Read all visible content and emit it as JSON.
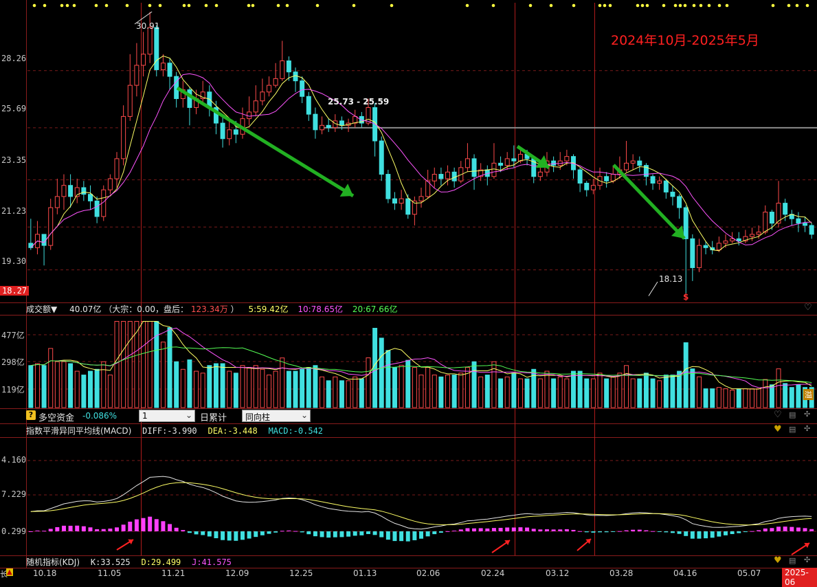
{
  "header": {
    "period_title": "2024年10月-2025年5月"
  },
  "price_panel": {
    "y_ticks": [
      "28.26",
      "25.69",
      "23.35",
      "21.23",
      "19.30"
    ],
    "y_ticks_values": [
      28.26,
      25.69,
      23.35,
      21.23,
      19.3
    ],
    "last_price_tag": "18.27",
    "high_label": "30.91",
    "low_label": "18.13",
    "resistance_label": "25.73 - 25.59",
    "resistance_value": 25.69,
    "dollar_marker": "$"
  },
  "volume_panel": {
    "title": "成交额▼",
    "value": "40.07亿",
    "paren": "（大宗：0.00，盘后：",
    "after_value": "123.34万",
    "paren_close": "）",
    "ma5": "5:59.42亿",
    "ma10": "10:78.65亿",
    "ma20": "20:67.66亿",
    "y_ticks": [
      "477亿",
      "298亿",
      "119亿"
    ],
    "corner_badge": "溢"
  },
  "fund_bar": {
    "help_icon": "?",
    "title": "多空资金",
    "value": "-0.086%",
    "select1": "1",
    "mode_label": "日累计",
    "select2": "同向柱"
  },
  "macd_panel": {
    "title": "指数平滑异同平均线(MACD)",
    "diff": "DIFF:-3.990",
    "dea": "DEA:-3.448",
    "macd": "MACD:-0.542",
    "y_ticks": [
      "4.160",
      "7.229",
      "0.299"
    ]
  },
  "kdj_panel": {
    "title": "随机指标(KDJ)",
    "k": "K:33.525",
    "d": "D:29.499",
    "j": "J:41.575"
  },
  "x_axis": {
    "left_marker": "长",
    "left_warn": "▲",
    "dates": [
      "10.18",
      "11.05",
      "11.21",
      "12.09",
      "12.25",
      "01.13",
      "02.06",
      "02.24",
      "03.12",
      "03.28",
      "04.16",
      "05.07"
    ],
    "current_date": "2025-06"
  },
  "colors": {
    "up": "#ff4b4b",
    "down": "#40e0e0",
    "ma5": "#ffff66",
    "ma10": "#ff55ff",
    "ma20": "#55ff55",
    "grid": "#7a1a1a",
    "arrow_green": "#22b022",
    "arrow_red": "#ff2222",
    "title_red": "#ff2020"
  },
  "chart_data": {
    "type": "candlestick",
    "ylim": [
      18.27,
      31.2
    ],
    "candles": [
      [
        20.5,
        20.3,
        21.6,
        20.2
      ],
      [
        20.3,
        20.9,
        21.5,
        20.0
      ],
      [
        20.9,
        20.4,
        20.9,
        19.5
      ],
      [
        20.4,
        22.1,
        22.5,
        20.2
      ],
      [
        22.1,
        22.6,
        23.4,
        21.8
      ],
      [
        22.6,
        23.1,
        23.6,
        22.0
      ],
      [
        23.1,
        22.6,
        23.6,
        22.1
      ],
      [
        22.6,
        23.0,
        23.4,
        22.3
      ],
      [
        23.0,
        22.7,
        23.3,
        22.4
      ],
      [
        22.7,
        22.4,
        23.1,
        22.0
      ],
      [
        22.4,
        21.7,
        22.6,
        21.4
      ],
      [
        21.7,
        22.9,
        23.1,
        21.5
      ],
      [
        22.9,
        23.4,
        23.6,
        22.7
      ],
      [
        23.4,
        24.3,
        24.6,
        23.0
      ],
      [
        24.3,
        26.2,
        26.7,
        24.0
      ],
      [
        26.2,
        27.6,
        29.0,
        26.0
      ],
      [
        27.6,
        28.5,
        29.5,
        27.1
      ],
      [
        28.5,
        29.0,
        30.0,
        28.0
      ],
      [
        29.0,
        30.2,
        30.9,
        28.6
      ],
      [
        30.2,
        28.3,
        30.3,
        28.0
      ],
      [
        28.3,
        28.6,
        29.0,
        28.0
      ],
      [
        28.6,
        28.0,
        28.8,
        27.4
      ],
      [
        28.0,
        27.0,
        28.2,
        26.6
      ],
      [
        27.0,
        27.4,
        27.8,
        26.6
      ],
      [
        27.4,
        26.6,
        27.5,
        25.8
      ],
      [
        26.6,
        27.0,
        27.4,
        26.3
      ],
      [
        27.0,
        27.3,
        27.8,
        26.8
      ],
      [
        27.3,
        26.6,
        27.6,
        26.2
      ],
      [
        26.6,
        25.9,
        26.9,
        25.4
      ],
      [
        25.9,
        25.2,
        26.3,
        24.8
      ],
      [
        25.2,
        25.6,
        26.0,
        24.9
      ],
      [
        25.6,
        25.4,
        26.0,
        25.0
      ],
      [
        25.4,
        26.1,
        26.6,
        25.2
      ],
      [
        26.1,
        26.4,
        27.1,
        25.8
      ],
      [
        26.4,
        26.9,
        27.6,
        26.2
      ],
      [
        26.9,
        27.3,
        27.9,
        26.7
      ],
      [
        27.3,
        27.6,
        28.0,
        27.1
      ],
      [
        27.6,
        27.9,
        28.6,
        27.5
      ],
      [
        27.9,
        28.7,
        29.6,
        27.8
      ],
      [
        28.7,
        28.2,
        28.9,
        27.8
      ],
      [
        28.2,
        27.8,
        28.4,
        27.3
      ],
      [
        27.8,
        27.1,
        28.0,
        26.8
      ],
      [
        27.1,
        26.3,
        27.3,
        26.0
      ],
      [
        26.3,
        25.6,
        26.6,
        25.2
      ],
      [
        25.6,
        25.8,
        26.2,
        25.4
      ],
      [
        25.8,
        25.7,
        26.1,
        25.5
      ],
      [
        25.7,
        26.0,
        26.3,
        25.5
      ],
      [
        26.0,
        25.8,
        26.2,
        25.6
      ],
      [
        25.8,
        25.9,
        26.1,
        25.5
      ],
      [
        25.9,
        26.2,
        26.5,
        25.7
      ],
      [
        26.2,
        25.9,
        26.4,
        25.7
      ],
      [
        25.9,
        26.6,
        27.0,
        25.8
      ],
      [
        26.6,
        25.1,
        26.8,
        24.4
      ],
      [
        25.1,
        23.6,
        25.3,
        23.3
      ],
      [
        23.6,
        22.5,
        23.8,
        22.3
      ],
      [
        22.5,
        22.3,
        22.8,
        22.0
      ],
      [
        22.3,
        22.5,
        22.9,
        22.0
      ],
      [
        22.5,
        21.8,
        22.7,
        21.6
      ],
      [
        21.8,
        22.4,
        22.6,
        21.3
      ],
      [
        22.4,
        22.6,
        23.0,
        22.1
      ],
      [
        22.6,
        23.3,
        23.8,
        22.5
      ],
      [
        23.3,
        23.6,
        23.9,
        23.0
      ],
      [
        23.6,
        23.4,
        23.9,
        23.1
      ],
      [
        23.4,
        23.7,
        24.0,
        23.1
      ],
      [
        23.7,
        23.3,
        23.9,
        23.0
      ],
      [
        23.3,
        23.9,
        24.2,
        23.2
      ],
      [
        23.9,
        24.3,
        25.0,
        23.7
      ],
      [
        24.3,
        23.5,
        24.5,
        22.9
      ],
      [
        23.5,
        23.8,
        24.1,
        23.3
      ],
      [
        23.8,
        23.5,
        24.0,
        23.1
      ],
      [
        23.5,
        24.1,
        25.0,
        23.4
      ],
      [
        24.1,
        24.0,
        24.4,
        23.7
      ],
      [
        24.0,
        24.3,
        24.6,
        23.8
      ],
      [
        24.3,
        24.2,
        24.9,
        23.9
      ],
      [
        24.2,
        24.5,
        24.8,
        24.1
      ],
      [
        24.5,
        24.3,
        24.7,
        24.0
      ],
      [
        24.3,
        23.5,
        24.4,
        23.2
      ],
      [
        23.5,
        23.7,
        24.0,
        23.3
      ],
      [
        23.7,
        24.2,
        24.6,
        23.5
      ],
      [
        24.2,
        24.0,
        24.4,
        23.7
      ],
      [
        24.0,
        24.2,
        24.6,
        23.8
      ],
      [
        24.2,
        24.4,
        24.7,
        24.0
      ],
      [
        24.4,
        23.8,
        24.5,
        23.4
      ],
      [
        23.8,
        23.2,
        23.9,
        22.8
      ],
      [
        23.2,
        22.9,
        23.3,
        22.6
      ],
      [
        22.9,
        23.1,
        23.4,
        22.7
      ],
      [
        23.1,
        23.5,
        23.9,
        22.9
      ],
      [
        23.5,
        23.3,
        23.7,
        23.0
      ],
      [
        23.3,
        23.6,
        24.0,
        23.2
      ],
      [
        23.6,
        23.8,
        24.4,
        23.4
      ],
      [
        23.8,
        24.1,
        25.1,
        23.7
      ],
      [
        24.1,
        24.2,
        24.5,
        23.8
      ],
      [
        24.2,
        24.0,
        24.4,
        23.7
      ],
      [
        24.0,
        23.5,
        24.1,
        23.1
      ],
      [
        23.5,
        23.2,
        23.6,
        22.9
      ],
      [
        23.2,
        23.3,
        23.5,
        22.9
      ],
      [
        23.3,
        22.8,
        23.4,
        22.5
      ],
      [
        22.8,
        22.6,
        23.1,
        22.2
      ],
      [
        22.6,
        22.1,
        22.7,
        21.6
      ],
      [
        22.1,
        20.7,
        22.2,
        18.13
      ],
      [
        20.7,
        19.4,
        20.9,
        18.8
      ],
      [
        19.4,
        20.4,
        20.7,
        19.2
      ],
      [
        20.4,
        20.3,
        20.6,
        20.0
      ],
      [
        20.3,
        20.2,
        20.6,
        20.0
      ],
      [
        20.2,
        20.5,
        20.8,
        20.1
      ],
      [
        20.5,
        20.6,
        20.9,
        20.3
      ],
      [
        20.6,
        20.7,
        21.0,
        20.5
      ],
      [
        20.7,
        20.6,
        21.0,
        20.4
      ],
      [
        20.6,
        20.8,
        21.1,
        20.5
      ],
      [
        20.8,
        20.9,
        21.2,
        20.6
      ],
      [
        20.9,
        21.0,
        21.3,
        20.7
      ],
      [
        21.0,
        21.9,
        22.2,
        20.9
      ],
      [
        21.9,
        21.4,
        22.0,
        21.1
      ],
      [
        21.4,
        22.3,
        23.3,
        21.2
      ],
      [
        22.3,
        21.8,
        22.5,
        21.5
      ],
      [
        21.8,
        21.6,
        22.0,
        21.3
      ],
      [
        21.6,
        21.4,
        21.9,
        21.0
      ],
      [
        21.4,
        21.3,
        21.7,
        21.0
      ],
      [
        21.3,
        20.9,
        21.4,
        20.7
      ]
    ],
    "volume_ylim": [
      0,
      530
    ],
    "volume_ticks": [
      477,
      298,
      119
    ],
    "macd_ticks": [
      "4.160",
      "7.229",
      "0.299"
    ]
  }
}
